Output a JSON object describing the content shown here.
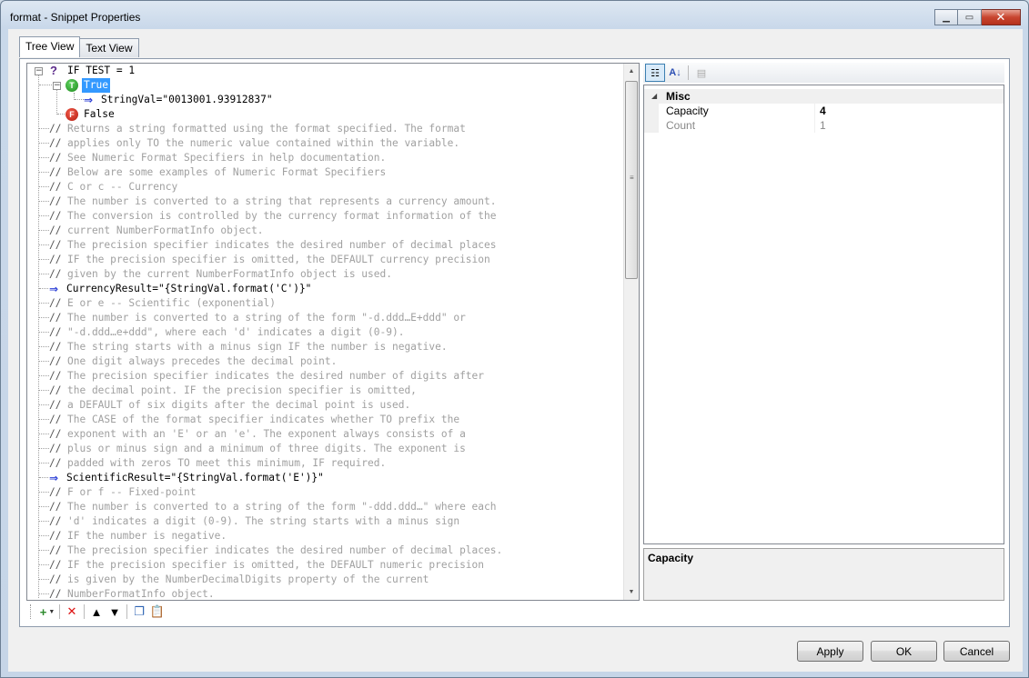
{
  "window": {
    "title": "format - Snippet Properties"
  },
  "tabs": [
    {
      "label": "Tree View",
      "active": true
    },
    {
      "label": "Text View",
      "active": false
    }
  ],
  "tree": {
    "root": "IF TEST = 1",
    "true_label": "True",
    "assignment": "StringVal=\"0013001.93912837\"",
    "false_label": "False",
    "badge_true": "T",
    "badge_false": "F",
    "lines": [
      {
        "kind": "comment",
        "text": "Returns a string formatted using the format specified. The format"
      },
      {
        "kind": "comment",
        "text": "applies only TO the numeric value contained within the variable."
      },
      {
        "kind": "comment",
        "text": "See Numeric Format Specifiers in help documentation."
      },
      {
        "kind": "comment",
        "text": "Below are some examples of Numeric Format Specifiers"
      },
      {
        "kind": "comment",
        "text": "C or c -- Currency"
      },
      {
        "kind": "comment",
        "text": "The number is converted to a string that represents a currency amount."
      },
      {
        "kind": "comment",
        "text": "The conversion is controlled by the currency format information of the"
      },
      {
        "kind": "comment",
        "text": "current NumberFormatInfo object."
      },
      {
        "kind": "comment",
        "text": "The precision specifier indicates the desired number of decimal places"
      },
      {
        "kind": "comment",
        "text": "IF the precision specifier is omitted, the DEFAULT currency precision"
      },
      {
        "kind": "comment",
        "text": "given by the current NumberFormatInfo object is used."
      },
      {
        "kind": "assign",
        "text": "CurrencyResult=\"{StringVal.format('C')}\""
      },
      {
        "kind": "comment",
        "text": "E or e -- Scientific (exponential)"
      },
      {
        "kind": "comment",
        "text": "The number is converted to a string of the form \"-d.ddd…E+ddd\" or"
      },
      {
        "kind": "comment",
        "text": "\"-d.ddd…e+ddd\", where each 'd' indicates a digit (0-9)."
      },
      {
        "kind": "comment",
        "text": "The string starts with a minus sign IF the number is negative."
      },
      {
        "kind": "comment",
        "text": "One digit always precedes the decimal point."
      },
      {
        "kind": "comment",
        "text": "The precision specifier indicates the desired number of digits after"
      },
      {
        "kind": "comment",
        "text": "the decimal point. IF the precision specifier is omitted,"
      },
      {
        "kind": "comment",
        "text": "a DEFAULT of six digits after the decimal point is used."
      },
      {
        "kind": "comment",
        "text": "The CASE of the format specifier indicates whether TO prefix the"
      },
      {
        "kind": "comment",
        "text": "exponent with an 'E' or an 'e'. The exponent always consists of a"
      },
      {
        "kind": "comment",
        "text": "plus or minus sign and a minimum of three digits. The exponent is"
      },
      {
        "kind": "comment",
        "text": "padded with zeros TO meet this minimum, IF required."
      },
      {
        "kind": "assign",
        "text": "ScientificResult=\"{StringVal.format('E')}\""
      },
      {
        "kind": "comment",
        "text": "F or f -- Fixed-point"
      },
      {
        "kind": "comment",
        "text": "The number is converted to a string of the form \"-ddd.ddd…\" where each"
      },
      {
        "kind": "comment",
        "text": "'d' indicates a digit (0-9). The string starts with a minus sign"
      },
      {
        "kind": "comment",
        "text": "IF the number is negative."
      },
      {
        "kind": "comment",
        "text": "The precision specifier indicates the desired number of decimal places."
      },
      {
        "kind": "comment",
        "text": "IF the precision specifier is omitted, the DEFAULT numeric precision"
      },
      {
        "kind": "comment",
        "text": "is given by the NumberDecimalDigits property of the current"
      },
      {
        "kind": "comment",
        "text": "NumberFormatInfo object."
      }
    ],
    "comment_marker": "//"
  },
  "properties": {
    "category": "Misc",
    "rows": [
      {
        "name": "Capacity",
        "value": "4",
        "bold": true
      },
      {
        "name": "Count",
        "value": "1",
        "bold": false
      }
    ],
    "description_title": "Capacity"
  },
  "buttons": {
    "apply": "Apply",
    "ok": "OK",
    "cancel": "Cancel"
  },
  "colors": {
    "selection": "#3399ff",
    "comment": "#a0a0a0",
    "badge_true": "#1f8a1f",
    "badge_false": "#b31d10"
  }
}
